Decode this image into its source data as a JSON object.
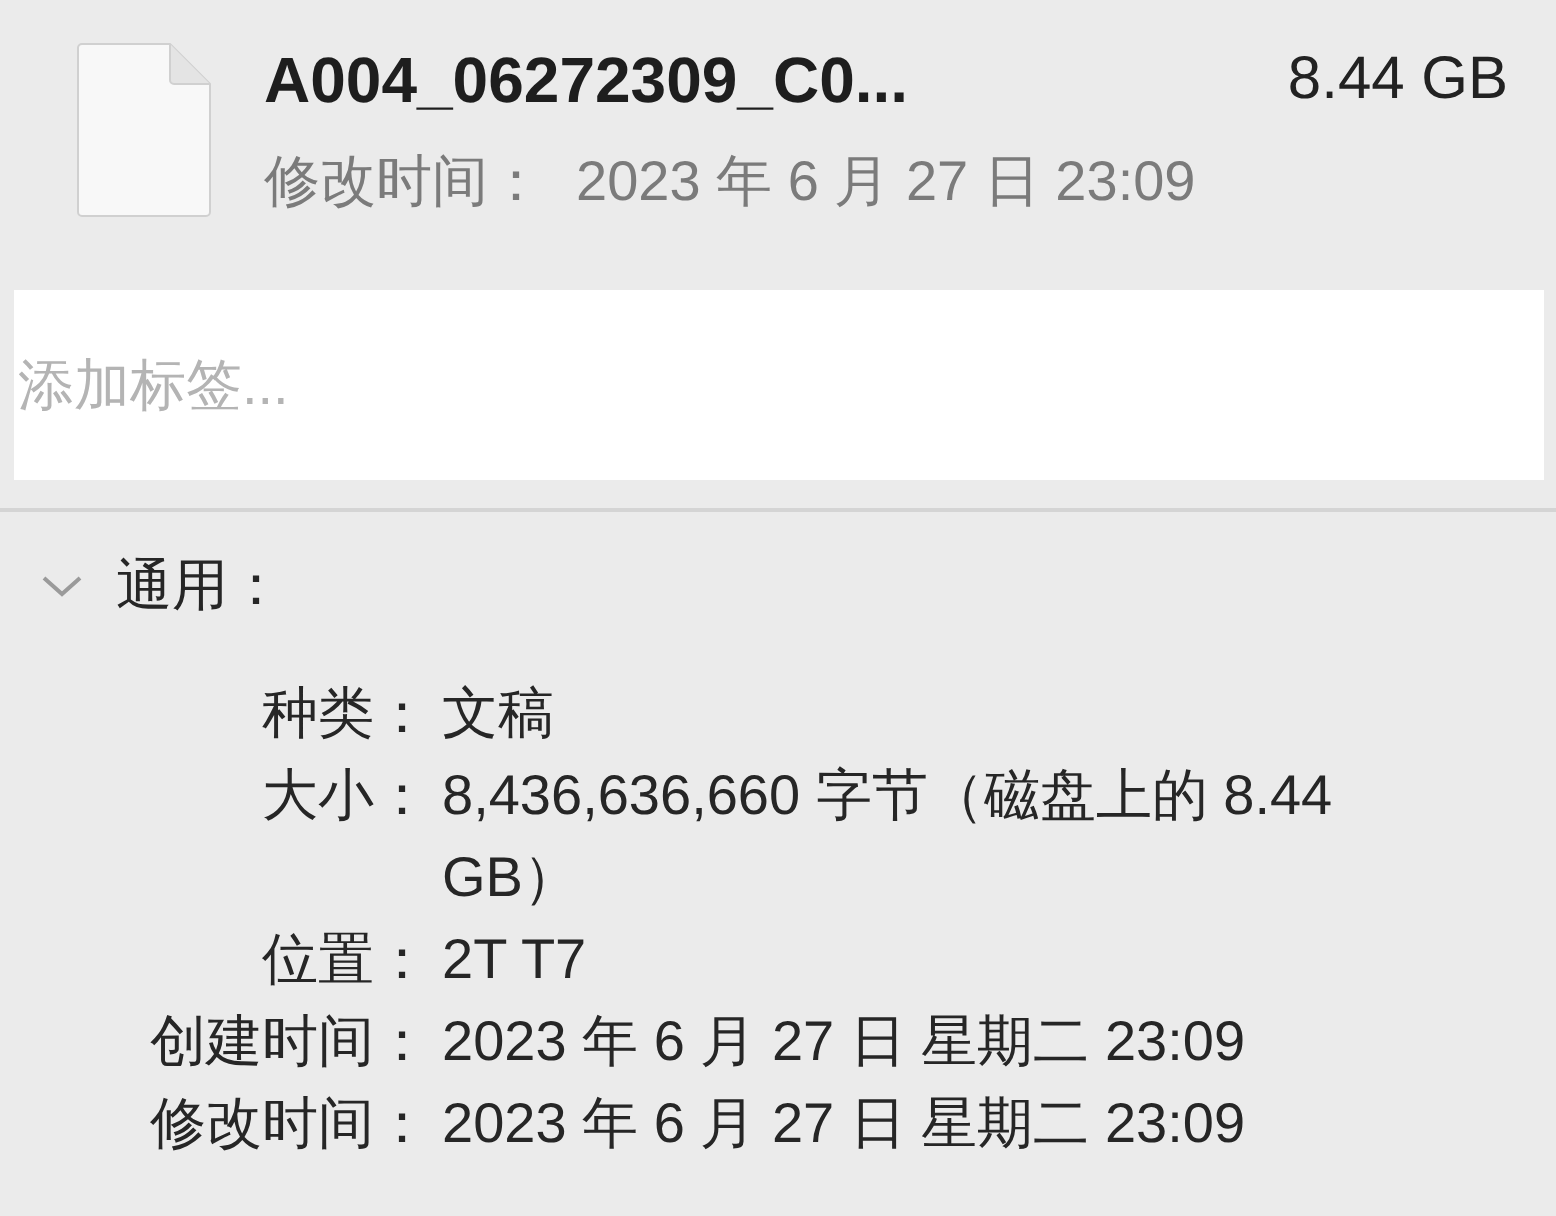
{
  "file": {
    "name": "A004_06272309_C0...",
    "size": "8.44 GB",
    "modified_label": "修改时间：",
    "modified": "2023 年 6 月 27 日 23:09"
  },
  "tags": {
    "placeholder": "添加标签..."
  },
  "general": {
    "title": "通用：",
    "expanded": true,
    "rows": [
      {
        "label": "种类：",
        "value": "文稿"
      },
      {
        "label": "大小：",
        "value": "8,436,636,660 字节（磁盘上的 8.44 GB）"
      },
      {
        "label": "位置：",
        "value": "2T T7"
      },
      {
        "label": "创建时间：",
        "value": "2023 年 6 月 27 日 星期二 23:09"
      },
      {
        "label": "修改时间：",
        "value": "2023 年 6 月 27 日 星期二 23:09"
      }
    ]
  }
}
